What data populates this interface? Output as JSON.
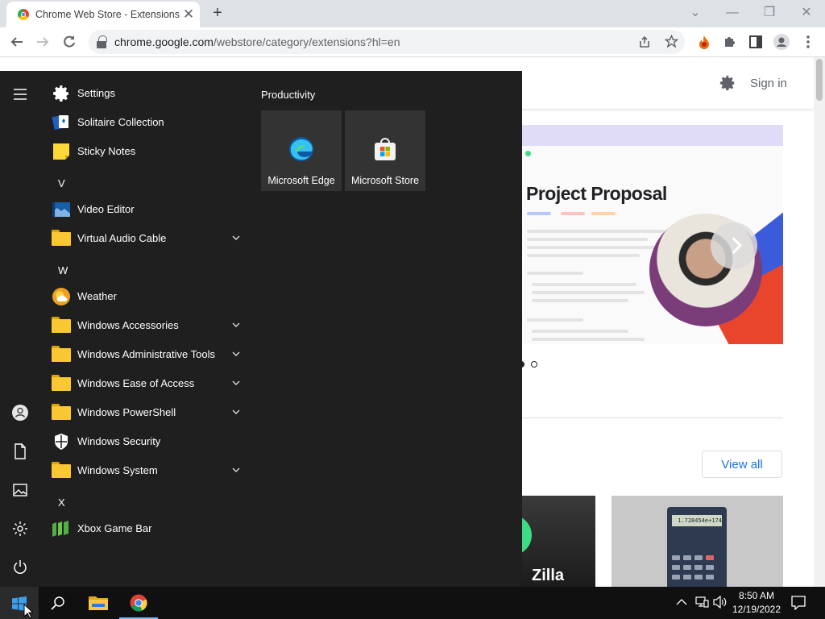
{
  "browser": {
    "tab_title": "Chrome Web Store - Extensions",
    "tab_close": "✕",
    "new_tab": "+",
    "window_controls": [
      "⌄",
      "—",
      "❐",
      "✕"
    ],
    "url_host": "chrome.google.com",
    "url_path": "/webstore/category/extensions?hl=en"
  },
  "page": {
    "sign_in": "Sign in",
    "banner_title": "Project Proposal",
    "view_all": "View all",
    "card1_text": "Zilla",
    "calc_display": "1.728454e+174"
  },
  "start_menu": {
    "apps": [
      {
        "label": "Settings",
        "icon": "gear-icon"
      },
      {
        "label": "Solitaire Collection",
        "icon": "cards-icon"
      },
      {
        "label": "Sticky Notes",
        "icon": "sticky-note-icon"
      },
      {
        "letter": "V"
      },
      {
        "label": "Video Editor",
        "icon": "video-editor-icon"
      },
      {
        "label": "Virtual Audio Cable",
        "icon": "folder-icon",
        "expandable": true
      },
      {
        "letter": "W"
      },
      {
        "label": "Weather",
        "icon": "weather-icon"
      },
      {
        "label": "Windows Accessories",
        "icon": "folder-icon",
        "expandable": true
      },
      {
        "label": "Windows Administrative Tools",
        "icon": "folder-icon",
        "expandable": true
      },
      {
        "label": "Windows Ease of Access",
        "icon": "folder-icon",
        "expandable": true
      },
      {
        "label": "Windows PowerShell",
        "icon": "folder-icon",
        "expandable": true
      },
      {
        "label": "Windows Security",
        "icon": "shield-icon"
      },
      {
        "label": "Windows System",
        "icon": "folder-icon",
        "expandable": true
      },
      {
        "letter": "X"
      },
      {
        "label": "Xbox Game Bar",
        "icon": "xbox-game-bar-icon"
      }
    ],
    "group_title": "Productivity",
    "tiles": [
      {
        "label": "Microsoft Edge",
        "icon": "edge-icon"
      },
      {
        "label": "Microsoft Store",
        "icon": "store-icon"
      }
    ]
  },
  "taskbar": {
    "time": "8:50 AM",
    "date": "12/19/2022"
  },
  "colors": {
    "start_bg": "#1f1f1f",
    "taskbar_bg": "#101010",
    "accent_blue": "#1a73e8",
    "folder_yellow": "#f9c732"
  }
}
